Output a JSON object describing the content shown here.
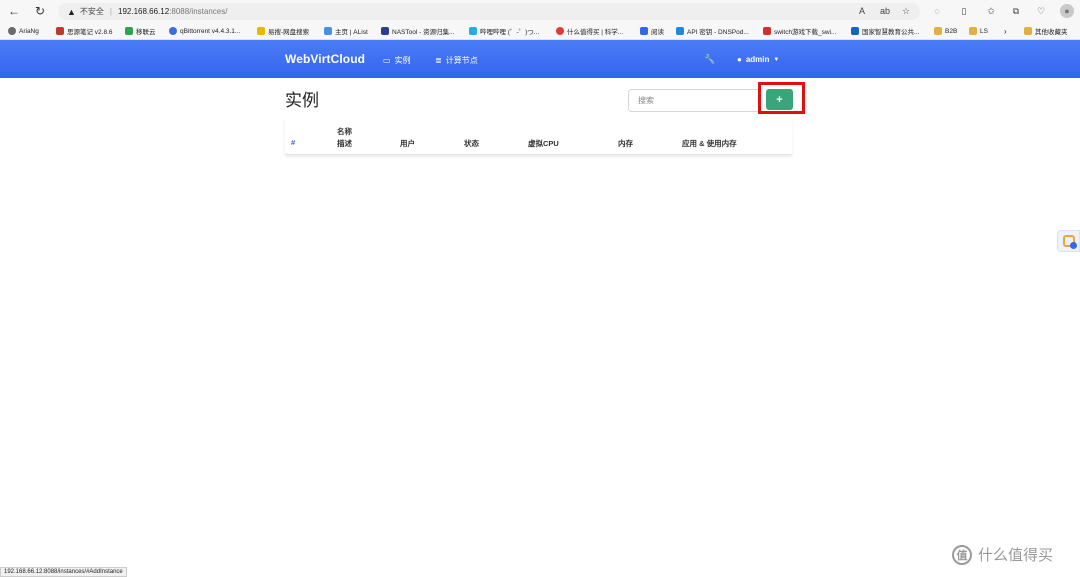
{
  "browser": {
    "security_warning": "不安全",
    "url_host": "192.168.66.12",
    "url_path": ":8088/instances/",
    "bookmarks": [
      {
        "label": "AriaNg",
        "color": "#6b6b6b"
      },
      {
        "label": "思源笔记 v2.8.6",
        "color": "#c0392b"
      },
      {
        "label": "移联云",
        "color": "#2ea44f"
      },
      {
        "label": "qBittorrent v4.4.3.1...",
        "color": "#3b6fd8"
      },
      {
        "label": "易搜-网盘搜索",
        "color": "#e6b800"
      },
      {
        "label": "主页 | AList",
        "color": "#4a90e2"
      },
      {
        "label": "NASTool - 资源归集...",
        "color": "#2c3e8f"
      },
      {
        "label": "哔哩哔哩 (゜-゜)つ...",
        "color": "#23ade5"
      },
      {
        "label": "什么值得买 | 科学...",
        "color": "#e53935"
      },
      {
        "label": "阅读",
        "color": "#3465ee"
      },
      {
        "label": "API 密钥 - DNSPod...",
        "color": "#1e88e5"
      },
      {
        "label": "switch游戏下载_swi...",
        "color": "#d32f2f"
      },
      {
        "label": "国家智慧教育公共...",
        "color": "#1565c0"
      },
      {
        "label": "B2B",
        "color": "#e0b040"
      },
      {
        "label": "LS",
        "color": "#e0b040"
      },
      {
        "label": "其他收藏夹",
        "color": "#e0b040"
      }
    ],
    "status_url": "192.168.66.12:8088/instances/#AddInstance"
  },
  "navbar": {
    "brand": "WebVirtCloud",
    "links": [
      {
        "label": "实例",
        "icon": "monitor-icon"
      },
      {
        "label": "计算节点",
        "icon": "server-icon"
      }
    ],
    "user": "admin"
  },
  "page": {
    "title": "实例",
    "search_placeholder": "搜索",
    "add_button": "+"
  },
  "table": {
    "headers": {
      "hash": "#",
      "name": "名称",
      "description": "描述",
      "user": "用户",
      "status": "状态",
      "vcpu": "虚拟CPU",
      "memory": "内存",
      "apps_memory": "应用 & 使用内存"
    }
  },
  "watermark": "什么值得买",
  "colors": {
    "navbar": "#3465ee",
    "add_button": "#3aa57a",
    "highlight": "#e01010"
  }
}
